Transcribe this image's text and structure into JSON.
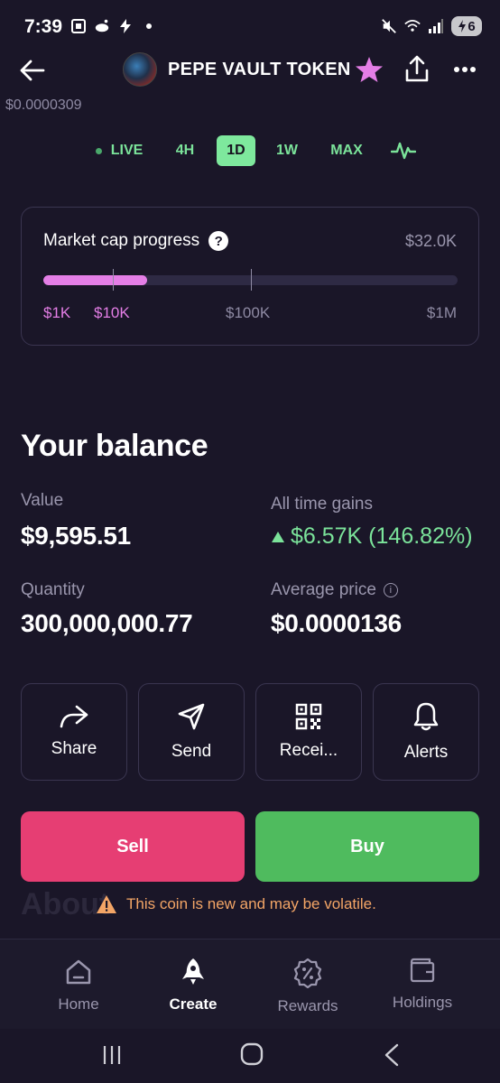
{
  "status_bar": {
    "time": "7:39",
    "battery": "6"
  },
  "header": {
    "token_name": "PEPE VAULT TOKEN"
  },
  "price_small": "$0.0000309",
  "timeframes": [
    {
      "label": "LIVE",
      "active": false
    },
    {
      "label": "4H",
      "active": false
    },
    {
      "label": "1D",
      "active": true
    },
    {
      "label": "1W",
      "active": false
    },
    {
      "label": "MAX",
      "active": false
    }
  ],
  "market_cap": {
    "title": "Market cap progress",
    "value": "$32.0K",
    "progress_fraction": 0.25,
    "labels": [
      "$1K",
      "$10K",
      "$100K",
      "$1M"
    ]
  },
  "balance": {
    "title": "Your balance",
    "value_label": "Value",
    "value": "$9,595.51",
    "gains_label": "All time gains",
    "gains": "$6.57K (146.82%)",
    "quantity_label": "Quantity",
    "quantity": "300,000,000.77",
    "avg_price_label": "Average price",
    "avg_price": "$0.0000136"
  },
  "actions": [
    {
      "label": "Share",
      "icon": "share-arrow-icon"
    },
    {
      "label": "Send",
      "icon": "send-icon"
    },
    {
      "label": "Recei...",
      "icon": "qr-code-icon"
    },
    {
      "label": "Alerts",
      "icon": "bell-icon"
    }
  ],
  "trade": {
    "sell": "Sell",
    "buy": "Buy"
  },
  "about_ghost": "About",
  "warning": "This coin is new and may be volatile.",
  "bottom_nav": [
    {
      "label": "Home",
      "icon": "home-icon",
      "active": false
    },
    {
      "label": "Create",
      "icon": "rocket-icon",
      "active": true
    },
    {
      "label": "Rewards",
      "icon": "rewards-badge-icon",
      "active": false
    },
    {
      "label": "Holdings",
      "icon": "wallet-icon",
      "active": false
    }
  ],
  "colors": {
    "background": "#1a1628",
    "accent_green": "#7be39a",
    "accent_pink": "#e47ee6",
    "sell": "#e63e73",
    "buy": "#4fbb5e",
    "warning": "#f3a566"
  }
}
